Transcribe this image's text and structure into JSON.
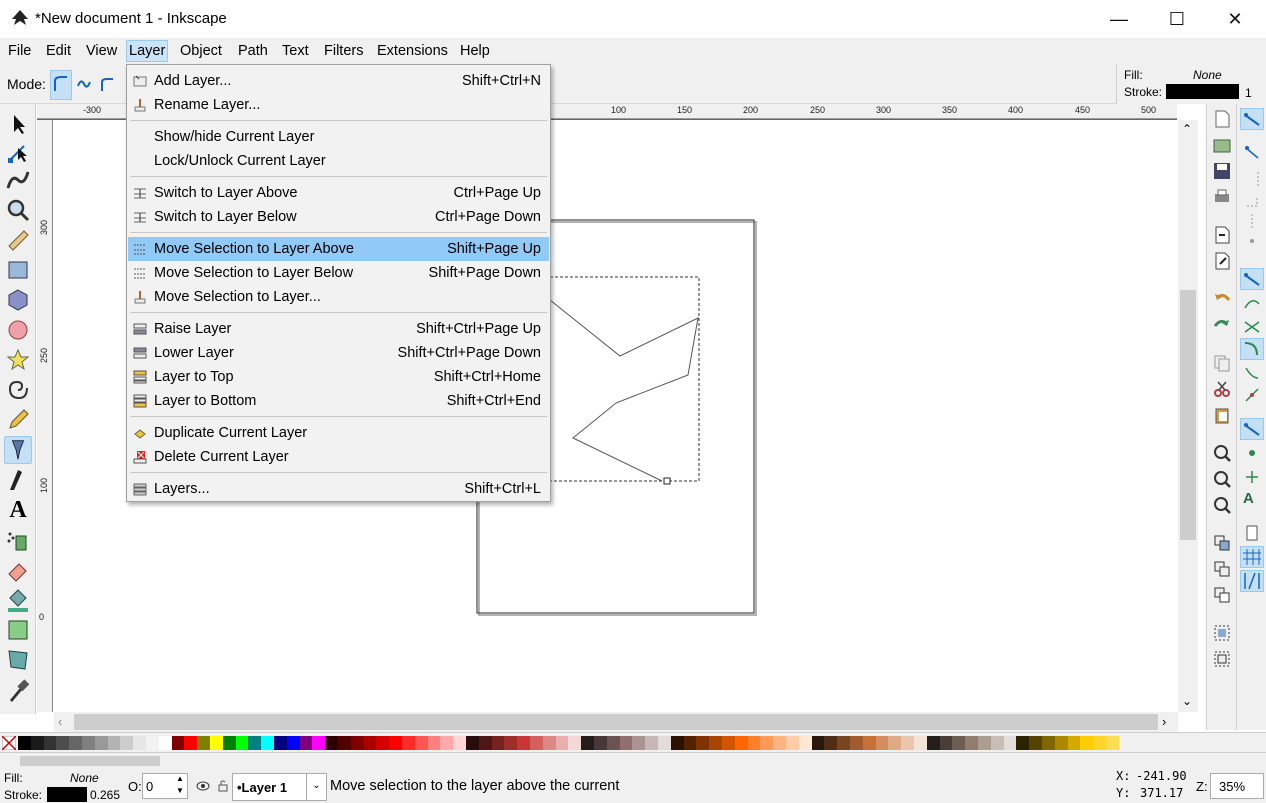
{
  "window": {
    "title": "*New document 1 - Inkscape"
  },
  "menubar": [
    "File",
    "Edit",
    "View",
    "Layer",
    "Object",
    "Path",
    "Text",
    "Filters",
    "Extensions",
    "Help"
  ],
  "toolctl": {
    "mode_label": "Mode:"
  },
  "style_indicator": {
    "fill_label": "Fill:",
    "fill_value": "None",
    "stroke_label": "Stroke:",
    "stroke_width": "1"
  },
  "ruler": {
    "h_labels": [
      "-300",
      "100",
      "150",
      "200",
      "250",
      "300",
      "350",
      "400",
      "450",
      "500"
    ],
    "v_labels": [
      "300",
      "250",
      "100",
      "0"
    ]
  },
  "layer_menu": {
    "items": [
      {
        "label": "Add Layer...",
        "shortcut": "Shift+Ctrl+N"
      },
      {
        "label": "Rename Layer...",
        "shortcut": ""
      },
      {
        "label": "Show/hide Current Layer",
        "shortcut": ""
      },
      {
        "label": "Lock/Unlock Current Layer",
        "shortcut": ""
      },
      {
        "label": "Switch to Layer Above",
        "shortcut": "Ctrl+Page Up"
      },
      {
        "label": "Switch to Layer Below",
        "shortcut": "Ctrl+Page Down"
      },
      {
        "label": "Move Selection to Layer Above",
        "shortcut": "Shift+Page Up"
      },
      {
        "label": "Move Selection to Layer Below",
        "shortcut": "Shift+Page Down"
      },
      {
        "label": "Move Selection to Layer...",
        "shortcut": ""
      },
      {
        "label": "Raise Layer",
        "shortcut": "Shift+Ctrl+Page Up"
      },
      {
        "label": "Lower Layer",
        "shortcut": "Shift+Ctrl+Page Down"
      },
      {
        "label": "Layer to Top",
        "shortcut": "Shift+Ctrl+Home"
      },
      {
        "label": "Layer to Bottom",
        "shortcut": "Shift+Ctrl+End"
      },
      {
        "label": "Duplicate Current Layer",
        "shortcut": ""
      },
      {
        "label": "Delete Current Layer",
        "shortcut": ""
      },
      {
        "label": "Layers...",
        "shortcut": "Shift+Ctrl+L"
      }
    ]
  },
  "status": {
    "fill_label": "Fill:",
    "fill_value": "None",
    "stroke_label": "Stroke:",
    "stroke_width": "0.265",
    "opacity_label": "O:",
    "opacity_value": "0",
    "layer": "•Layer 1",
    "message": "Move selection to the layer above the current",
    "x_label": "X:",
    "x_value": "-241.90",
    "y_label": "Y:",
    "y_value": "371.17",
    "zoom_label": "Z:",
    "zoom_value": "35%"
  },
  "palette_colors": [
    "#000000",
    "#1a1a1a",
    "#333333",
    "#4d4d4d",
    "#666666",
    "#808080",
    "#999999",
    "#b3b3b3",
    "#cccccc",
    "#e6e6e6",
    "#f2f2f2",
    "#ffffff",
    "#800000",
    "#ff0000",
    "#808000",
    "#ffff00",
    "#008000",
    "#00ff00",
    "#008080",
    "#00ffff",
    "#000080",
    "#0000ff",
    "#800080",
    "#ff00ff",
    "#2b0000",
    "#550000",
    "#800000",
    "#aa0000",
    "#d40000",
    "#ff0000",
    "#ff2a2a",
    "#ff5555",
    "#ff8080",
    "#ffaaaa",
    "#ffd5d5",
    "#280b0b",
    "#501616",
    "#782121",
    "#a02c2c",
    "#c83737",
    "#d35f5f",
    "#de8787",
    "#e9afaf",
    "#f4d7d7",
    "#241c1c",
    "#483737",
    "#6c5353",
    "#916f6f",
    "#ac9393",
    "#c8b7b7",
    "#e3dbdb",
    "#2b1100",
    "#552200",
    "#803300",
    "#aa4400",
    "#d45500",
    "#ff6600",
    "#ff7f2a",
    "#ff9955",
    "#ffb380",
    "#ffccaa",
    "#ffe6d5",
    "#28170b",
    "#502d16",
    "#784421",
    "#a05a2c",
    "#c87137",
    "#d38d5f",
    "#deaa87",
    "#e9c6af",
    "#f4e3d7",
    "#241f1c",
    "#483e37",
    "#6c5d53",
    "#917c6f",
    "#ac9d93",
    "#c8beb7",
    "#e3dedb",
    "#2b2200",
    "#554400",
    "#806600",
    "#aa8800",
    "#d4aa00",
    "#ffcc00",
    "#ffd42a",
    "#ffdd55"
  ]
}
